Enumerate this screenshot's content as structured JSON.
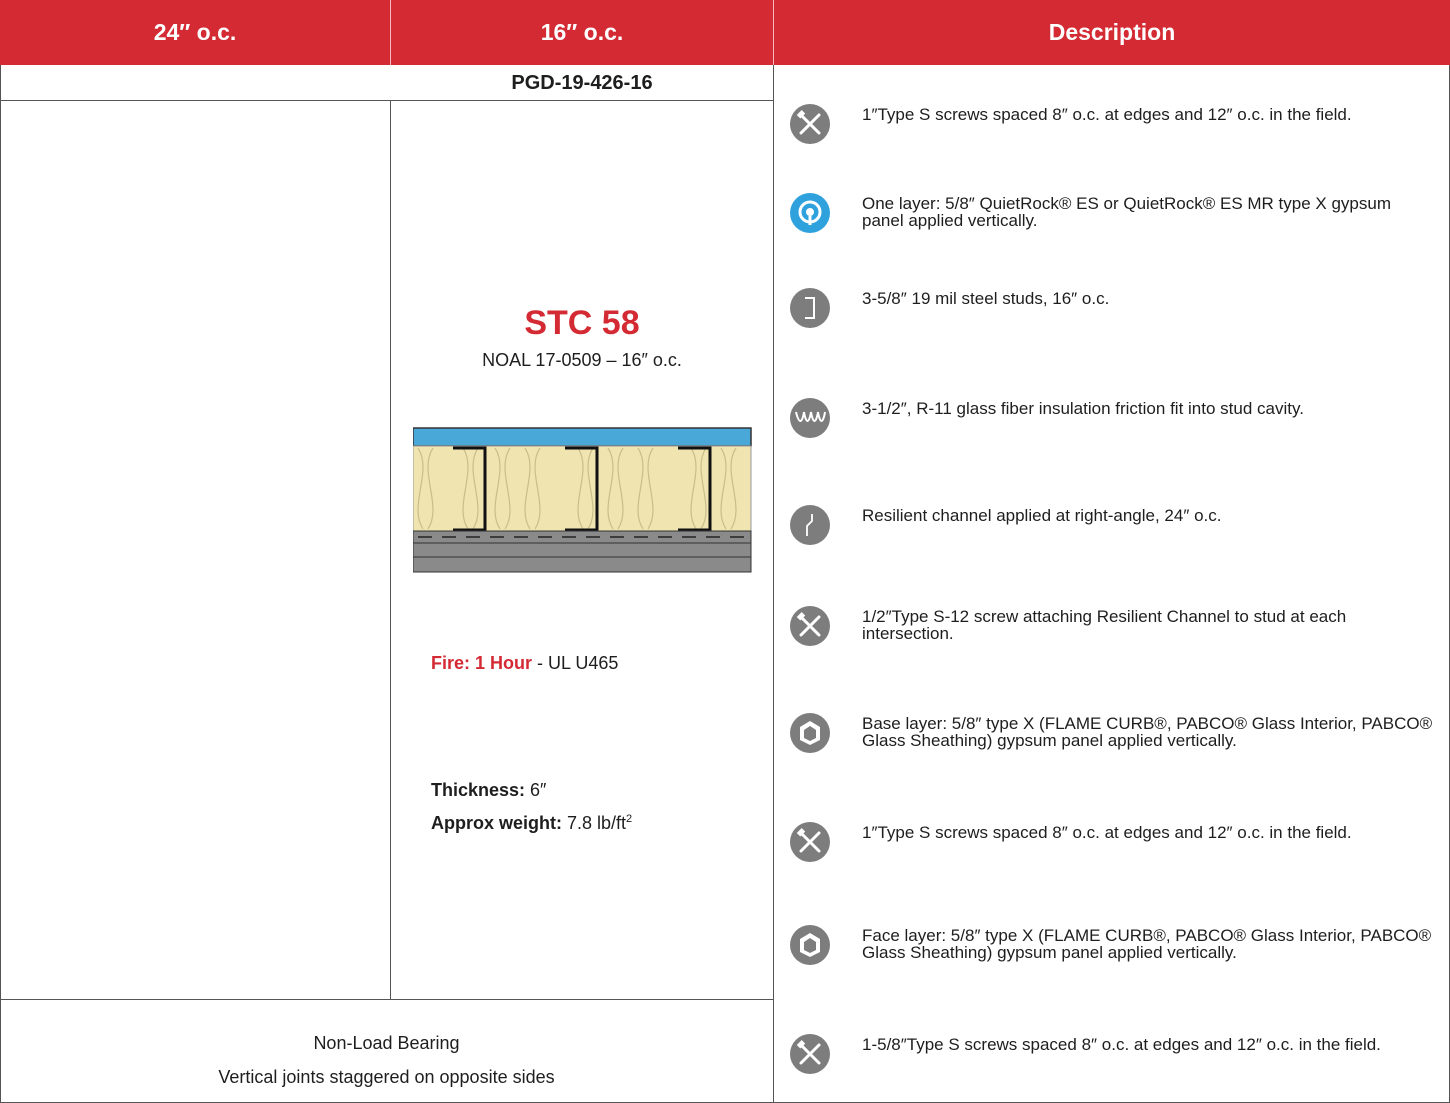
{
  "header": {
    "col1": "24″ o.c.",
    "col2": "16″ o.c.",
    "col3": "Description"
  },
  "assembly": {
    "code": "PGD-19-426-16",
    "stc": "STC 58",
    "test_ref": "NOAL 17-0509 – 16″ o.c.",
    "fire_label": "Fire: 1 Hour",
    "fire_rest": " - UL U465",
    "thickness_label": "Thickness:",
    "thickness_value": " 6″",
    "weight_label": "Approx weight:",
    "weight_value": " 7.8 lb/ft",
    "weight_sup": "2"
  },
  "footer": {
    "line1": "Non-Load Bearing",
    "line2": "Vertical joints staggered on opposite sides"
  },
  "colors": {
    "brand_red": "#d42a33",
    "icon_gray": "#7d7d7d",
    "icon_blue": "#2fa2de",
    "panel_blue": "#4aa8d8",
    "insulation": "#f0e5b0",
    "board_gray": "#8a8a8a"
  },
  "descriptions": [
    {
      "icon": "screw-tools-icon",
      "text": "1″Type S screws spaced 8″ o.c. at edges and 12″ o.c. in the field."
    },
    {
      "icon": "quietrock-icon",
      "text": "One layer: 5/8″ QuietRock® ES or QuietRock® ES MR type X gypsum panel applied vertically."
    },
    {
      "icon": "steel-stud-icon",
      "text": "3-5/8″ 19 mil steel studs, 16″ o.c."
    },
    {
      "icon": "insulation-icon",
      "text": "3-1/2″, R-11 glass fiber insulation friction fit into stud cavity."
    },
    {
      "icon": "resilient-channel-icon",
      "text": "Resilient channel applied at right-angle, 24″ o.c."
    },
    {
      "icon": "screw-tools-icon",
      "text": "1/2″Type S-12 screw attaching Resilient Channel to stud at each intersection."
    },
    {
      "icon": "gypsum-panel-icon",
      "text": "Base layer: 5/8″ type X (FLAME CURB®, PABCO® Glass Interior, PABCO® Glass Sheathing) gypsum panel applied vertically."
    },
    {
      "icon": "screw-tools-icon",
      "text": "1″Type S screws spaced 8″ o.c. at edges and 12″ o.c. in the field."
    },
    {
      "icon": "gypsum-panel-icon",
      "text": "Face layer: 5/8″ type X (FLAME CURB®, PABCO® Glass Interior, PABCO® Glass Sheathing) gypsum panel applied vertically."
    },
    {
      "icon": "screw-tools-icon",
      "text": "1-5/8″Type S screws spaced 8″ o.c. at edges and 12″ o.c. in the field."
    }
  ]
}
